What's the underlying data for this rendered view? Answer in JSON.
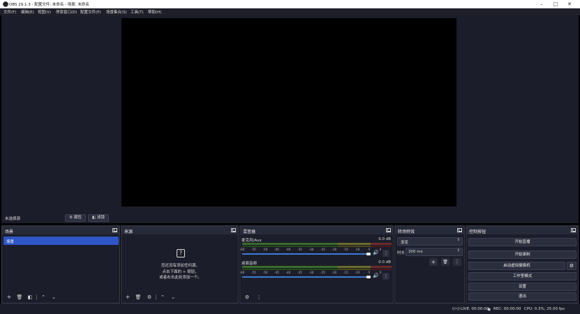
{
  "window": {
    "title": "OBS 29.1.3 - 配置文件: 未命名 - 场景: 未命名"
  },
  "menu": [
    "文件(F)",
    "编辑(E)",
    "视图(V)",
    "停靠窗口(D)",
    "配置文件(P)",
    "场景集合(S)",
    "工具(T)",
    "帮助(H)"
  ],
  "source_toolbar": {
    "no_source": "未选择源",
    "properties": "属性",
    "filters": "滤镜"
  },
  "scenes": {
    "title": "场景",
    "items": [
      "场景"
    ]
  },
  "sources": {
    "title": "来源",
    "empty_line1": "您还没有添加任何源。",
    "empty_line2": "点击下面的 + 按钮，",
    "empty_line3": "或者右击此处添加一个。"
  },
  "mixer": {
    "title": "混音器",
    "tracks": [
      {
        "name": "麦克风/Aux",
        "level": "0.0 dB"
      },
      {
        "name": "桌面音频",
        "level": "0.0 dB"
      }
    ],
    "ticks": [
      "-60",
      "-55",
      "-50",
      "-45",
      "-40",
      "-35",
      "-30",
      "-25",
      "-20",
      "-15",
      "-10",
      "-5",
      "0"
    ]
  },
  "transitions": {
    "title": "转场特效",
    "selected": "渐变",
    "duration_label": "时长",
    "duration_value": "300 ms"
  },
  "controls": {
    "title": "控制按钮",
    "start_stream": "开始直播",
    "start_record": "开始录制",
    "virtual_cam": "启动虚拟摄像机",
    "studio_mode": "工作室模式",
    "settings": "设置",
    "exit": "退出"
  },
  "status": {
    "live": "LIVE: 00:00:00",
    "rec": "REC: 00:00:00",
    "cpu": "CPU: 0.3%, 25.00 fps"
  },
  "colors": {
    "accent": "#2f56c7",
    "panel": "#1c1d2a",
    "header": "#272a39"
  }
}
